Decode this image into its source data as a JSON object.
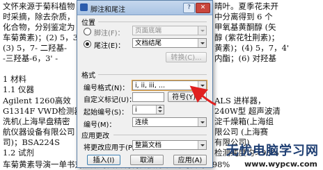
{
  "document": {
    "lines_left": [
      "文怀来源于菊科植物",
      "时采摘，除去杂质，",
      "化合物，分别鉴定为",
      "车菊黄素)；(2) 5，3",
      "(3) 5，7- 二羟基-",
      "-三羟基-6，3' -",
      "-三羟基-6，3' -",
      "1  材料",
      "1.1 仪器",
      "Agilent  1260高效",
      "G1314F  VWD检测器",
      "洗机(上海早盘精密",
      "航仪器设备有限公司",
      "司)；BSA224S",
      "1.2 试剂"
    ],
    "lines_right": [
      "晴叶。夏季花未开",
      "中分离得到 6 个",
      "甲氧基黄酮醇 (矢",
      "醇 (紫花牡荆素)；",
      "黄素)；(4) 5，7，4'",
      "内酯；(6) 对羟基",
      "",
      "",
      "",
      "ALS 进样器，",
      "240W型  超声波清",
      "淀千燥箱(上海组",
      "限公司 (上海赛",
      "有限公司)",
      "检测纯度均>98%"
    ],
    "bottom_line": "车菊黄素导演一单书对照品均由自制制备获得 检测纯度均>98%"
  },
  "dialog": {
    "title": "脚注和尾注",
    "help": "?",
    "close": "✕",
    "location_heading": "位置",
    "footnote_label": "脚注(F)：",
    "footnote_value": "页面底端",
    "endnote_label": "尾注(E)：",
    "endnote_value": "文档结尾",
    "convert_button": "转换(C)...",
    "format_heading": "格式",
    "number_format_label": "编号格式(N)：",
    "number_format_value": "i, ii, iii, ...",
    "custom_mark_label": "自定义标记(U)：",
    "custom_mark_value": "",
    "symbol_button": "符号(Y)...",
    "start_at_label": "起始编号(S)：",
    "start_at_value": "i",
    "numbering_label": "编号(M)：",
    "numbering_value": "连续",
    "apply_heading": "应用更改",
    "apply_to_label": "将更改应用于(P)：",
    "apply_to_value": "整篇文档",
    "insert_button": "插入(I)",
    "cancel_button": "取消",
    "apply_button": "应用(A)"
  },
  "watermark": {
    "title": "无忧电脑学习网",
    "url": "www.wypcw.com"
  },
  "colors": {
    "arrow": "#e02020",
    "titlebar": "#b7cde9",
    "close": "#c9463d"
  }
}
